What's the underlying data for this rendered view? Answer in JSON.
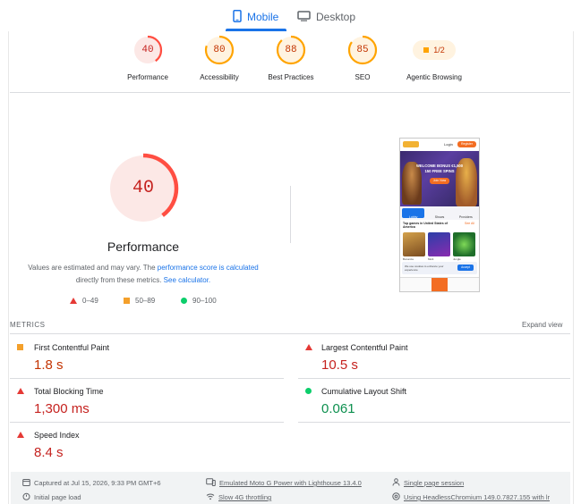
{
  "tabs": [
    {
      "label": "Mobile",
      "icon": "phone-icon",
      "active": true
    },
    {
      "label": "Desktop",
      "icon": "monitor-icon",
      "active": false
    }
  ],
  "categories": [
    {
      "score": "40",
      "label": "Performance",
      "status": "fail",
      "value": 40
    },
    {
      "score": "80",
      "label": "Accessibility",
      "status": "average",
      "value": 80
    },
    {
      "score": "88",
      "label": "Best Practices",
      "status": "average",
      "value": 88
    },
    {
      "score": "85",
      "label": "SEO",
      "status": "average",
      "value": 85
    },
    {
      "score": "1/2",
      "label": "Agentic Browsing",
      "status": "average"
    }
  ],
  "main": {
    "score": "40",
    "score_value": 40,
    "title": "Performance",
    "note_prefix": "Values are estimated and may vary. The ",
    "note_link1": "performance score is calculated",
    "note_middle": "directly from these metrics. ",
    "note_link2": "See calculator."
  },
  "legend": [
    {
      "range": "0–49",
      "shape": "triangle",
      "color": "#e53935"
    },
    {
      "range": "50–89",
      "shape": "square",
      "color": "#f4a02b"
    },
    {
      "range": "90–100",
      "shape": "circle",
      "color": "#0cce6b"
    }
  ],
  "metrics_header": {
    "title": "METRICS",
    "expand": "Expand view"
  },
  "metrics": [
    {
      "name": "First Contentful Paint",
      "value": "1.8 s",
      "status": "average"
    },
    {
      "name": "Largest Contentful Paint",
      "value": "10.5 s",
      "status": "fail"
    },
    {
      "name": "Total Blocking Time",
      "value": "1,300 ms",
      "status": "fail"
    },
    {
      "name": "Cumulative Layout Shift",
      "value": "0.061",
      "status": "pass"
    },
    {
      "name": "Speed Index",
      "value": "8.4 s",
      "status": "fail"
    }
  ],
  "footer": {
    "captured": "Captured at Jul 15, 2026, 9:33 PM GMT+6",
    "device": "Emulated Moto G Power with Lighthouse 13.4.0",
    "session": "Single page session",
    "load": "Initial page load",
    "throttling": "Slow 4G throttling",
    "browser": "Using HeadlessChromium 149.0.7827.155 with lr"
  },
  "screenshot": {
    "login": "Login",
    "register": "Register",
    "banner_line1": "WELCOME BONUS €1,500",
    "banner_line2": "150 FREE SPINS",
    "banner_cta": "Join Now",
    "nav": [
      "Lobby",
      "Shows",
      "Providers"
    ],
    "section_title": "Top games in United States of America",
    "see_all": "See All",
    "games": [
      "Bonanza",
      "Multi",
      "Jungle"
    ],
    "accept": "Accept",
    "cookie_text": "We use cookies to enhance your experience"
  },
  "colors": {
    "fail": "#ff4e42",
    "average": "#ffa400",
    "pass": "#0cce6b",
    "fail_bg": "#fce8e6",
    "average_bg": "#fff3e0",
    "accent": "#1a73e8"
  }
}
